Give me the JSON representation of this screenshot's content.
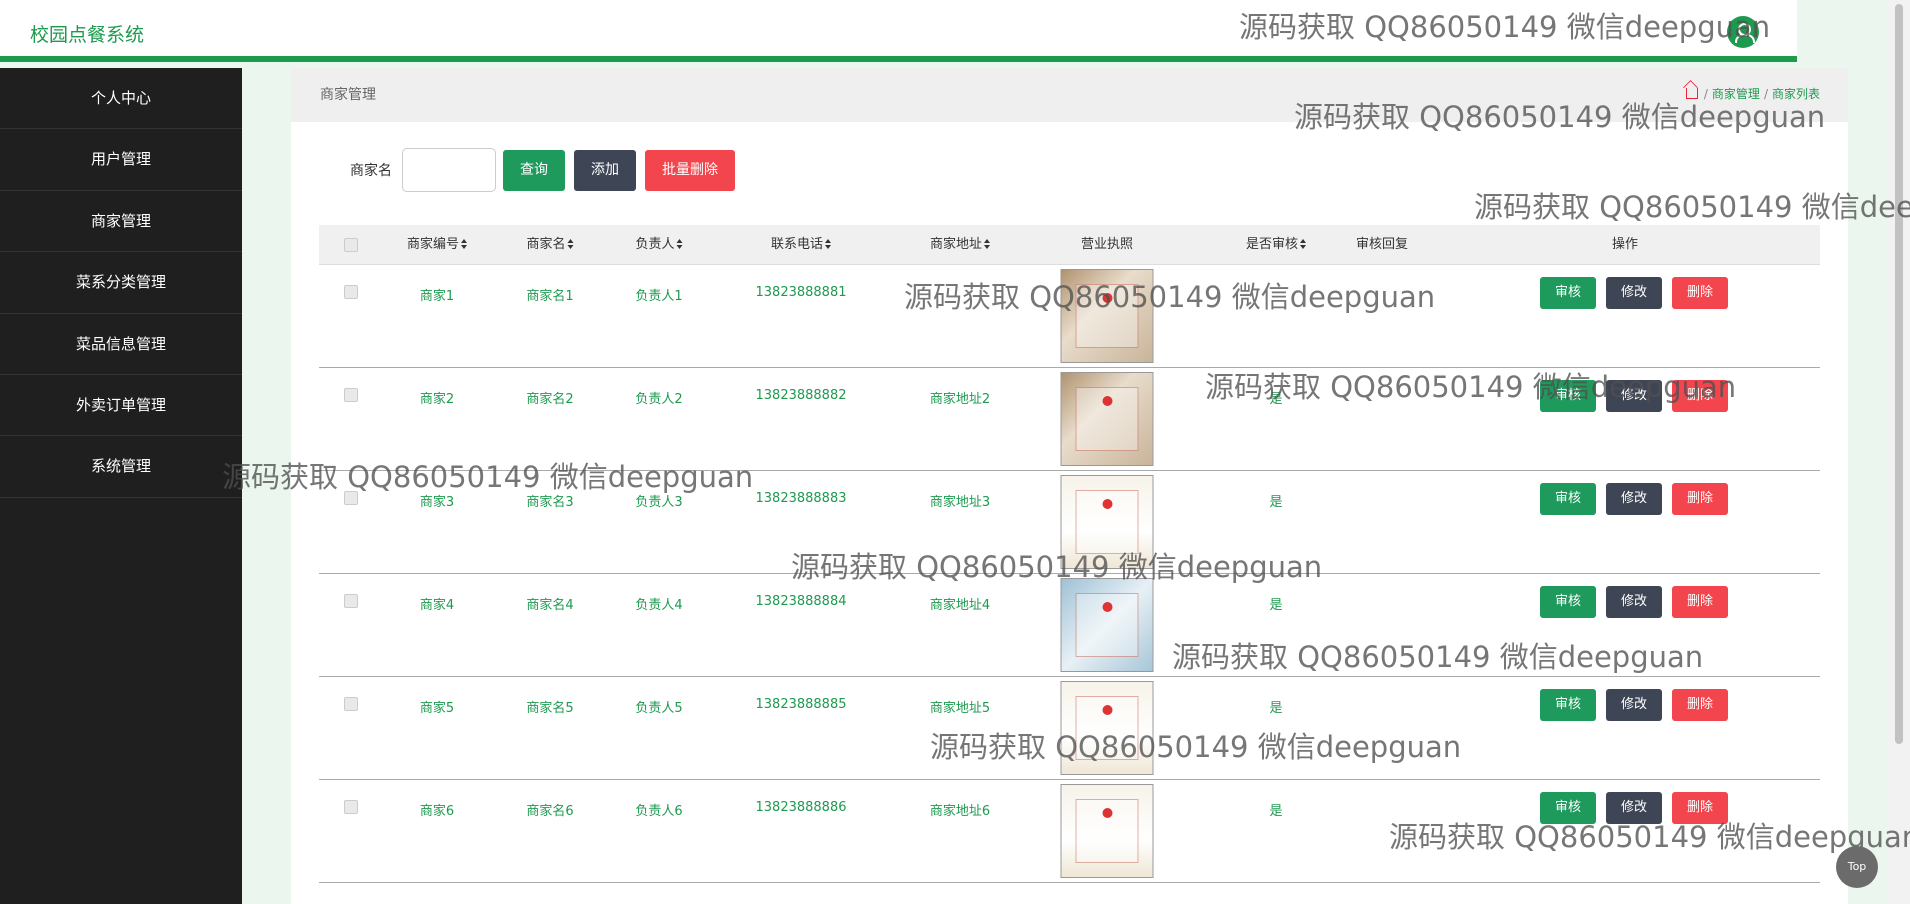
{
  "app": {
    "title": "校园点餐系统"
  },
  "sidebar": {
    "items": [
      "个人中心",
      "用户管理",
      "商家管理",
      "菜系分类管理",
      "菜品信息管理",
      "外卖订单管理",
      "系统管理"
    ]
  },
  "breadcrumb": {
    "section": "商家管理",
    "trail": [
      "商家管理",
      "商家列表"
    ]
  },
  "search": {
    "label": "商家名",
    "value": "",
    "placeholder": ""
  },
  "toolbar": {
    "query": "查询",
    "add": "添加",
    "batch_delete": "批量删除"
  },
  "table": {
    "headers": [
      "商家编号",
      "商家名",
      "负责人",
      "联系电话",
      "商家地址",
      "营业执照",
      "是否审核",
      "审核回复",
      "操作"
    ],
    "rows": [
      {
        "id": "商家1",
        "name": "商家名1",
        "owner": "负责人1",
        "phone": "13823888881",
        "address": "",
        "approved": ""
      },
      {
        "id": "商家2",
        "name": "商家名2",
        "owner": "负责人2",
        "phone": "13823888882",
        "address": "商家地址2",
        "approved": "是"
      },
      {
        "id": "商家3",
        "name": "商家名3",
        "owner": "负责人3",
        "phone": "13823888883",
        "address": "商家地址3",
        "approved": "是"
      },
      {
        "id": "商家4",
        "name": "商家名4",
        "owner": "负责人4",
        "phone": "13823888884",
        "address": "商家地址4",
        "approved": "是"
      },
      {
        "id": "商家5",
        "name": "商家名5",
        "owner": "负责人5",
        "phone": "13823888885",
        "address": "商家地址5",
        "approved": "是"
      },
      {
        "id": "商家6",
        "name": "商家名6",
        "owner": "负责人6",
        "phone": "13823888886",
        "address": "商家地址6",
        "approved": "是"
      }
    ],
    "row_actions": {
      "review": "审核",
      "edit": "修改",
      "delete": "删除"
    }
  },
  "watermark_text": "源码获取 QQ86050149 微信deepguan",
  "top_button": "Top",
  "colors": {
    "brand_green": "#1e9a4f",
    "sidebar_bg": "#1f1f1f",
    "btn_green": "#1e9a5c",
    "btn_dark": "#3e4656",
    "btn_red": "#f2454e"
  }
}
